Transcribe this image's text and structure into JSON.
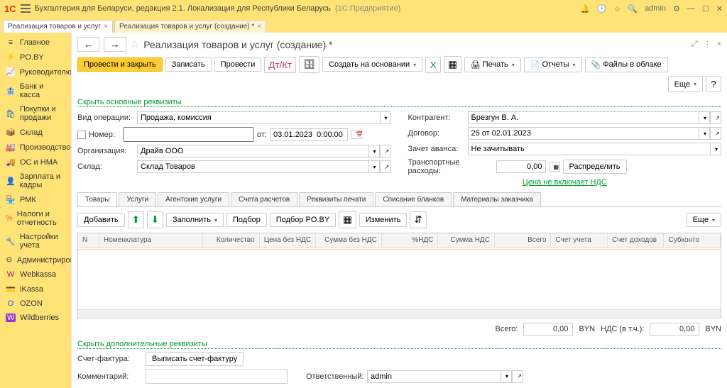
{
  "titlebar": {
    "app_title": "Бухгалтерия для Беларуси, редакция 2.1. Локализация для Республики Беларусь",
    "app_sub": "(1С:Предприятие)",
    "user": "admin"
  },
  "tabs": [
    {
      "label": "Реализация товаров и услуг"
    },
    {
      "label": "Реализация товаров и услуг (создание) *"
    }
  ],
  "sidebar": [
    {
      "icon": "≡",
      "label": "Главное"
    },
    {
      "icon": "⚡",
      "label": "PO.BY"
    },
    {
      "icon": "📈",
      "label": "Руководителю"
    },
    {
      "icon": "🏦",
      "label": "Банк и касса"
    },
    {
      "icon": "🛍",
      "label": "Покупки и продажи"
    },
    {
      "icon": "📦",
      "label": "Склад"
    },
    {
      "icon": "🏭",
      "label": "Производство"
    },
    {
      "icon": "🚚",
      "label": "ОС и НМА"
    },
    {
      "icon": "👤",
      "label": "Зарплата и кадры"
    },
    {
      "icon": "🏪",
      "label": "РМК"
    },
    {
      "icon": "%",
      "label": "Налоги и отчетность"
    },
    {
      "icon": "🔧",
      "label": "Настройки учета"
    },
    {
      "icon": "⚙",
      "label": "Администрирование"
    },
    {
      "icon": "W",
      "label": "Webkassa"
    },
    {
      "icon": "💳",
      "label": "iKassa"
    },
    {
      "icon": "O",
      "label": "OZON"
    },
    {
      "icon": "W",
      "label": "Wildberries"
    }
  ],
  "page": {
    "title": "Реализация товаров и услуг (создание) *",
    "collapse_link": "Скрыть основные реквизиты",
    "toolbar": {
      "post_close": "Провести и закрыть",
      "save": "Записать",
      "post": "Провести",
      "create_based": "Создать на основании",
      "print": "Печать",
      "reports": "Отчеты",
      "files": "Файлы в облаке",
      "more": "Еще"
    },
    "fields": {
      "op_type_label": "Вид операции:",
      "op_type_value": "Продажа, комиссия",
      "number_label": "Номер:",
      "from_label": "от:",
      "date_value": "03.01.2023  0:00:00",
      "org_label": "Организация:",
      "org_value": "Драйв ООО",
      "wh_label": "Склад:",
      "wh_value": "Склад Товаров",
      "contr_label": "Контрагент:",
      "contr_value": "Брезгун В. А.",
      "dog_label": "Договор:",
      "dog_value": "25 от 02.01.2023",
      "advance_label": "Зачет аванса:",
      "advance_value": "Не зачитывать",
      "trans_label": "Транспортные расходы:",
      "trans_value": "0,00",
      "distribute": "Распределить",
      "price_note": "Цена не включает НДС"
    },
    "doctabs": [
      "Товары",
      "Услуги",
      "Агентские услуги",
      "Счета расчетов",
      "Реквизиты печати",
      "Списание бланков",
      "Материалы заказчика"
    ],
    "subtoolbar": {
      "add": "Добавить",
      "fill": "Заполнить",
      "pick": "Подбор",
      "pick_poby": "Подбор PO.BY",
      "change": "Изменить",
      "more2": "Еще"
    },
    "grid": {
      "columns": [
        "N",
        "Номенклатура",
        "Количество",
        "Цена без НДС",
        "Сумма без НДС",
        "%НДС",
        "Сумма НДС",
        "Всего",
        "Счет учета",
        "Счет доходов",
        "Субконто"
      ]
    },
    "totals": {
      "total_label": "Всего:",
      "total_value": "0,00",
      "cur1": "BYN",
      "nds_label": "НДС (в т.ч.):",
      "nds_value": "0,00",
      "cur2": "BYN"
    },
    "bottom": {
      "collapse_link2": "Скрыть дополнительные реквизиты",
      "sf_label": "Счет-фактура:",
      "sf_btn": "Выписать счет-фактуру",
      "comment_label": "Комментарий:",
      "resp_label": "Ответственный:",
      "resp_value": "admin"
    }
  }
}
